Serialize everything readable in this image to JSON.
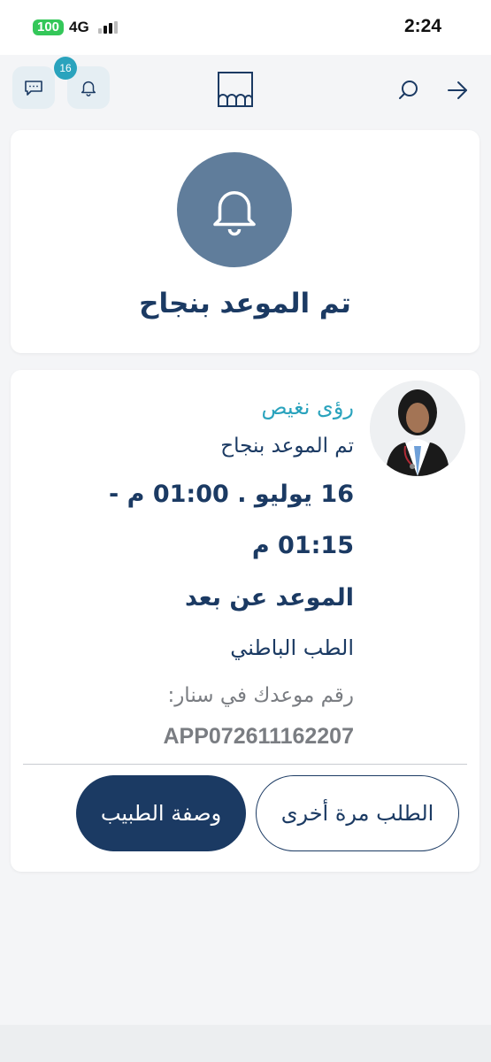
{
  "status_bar": {
    "battery": "100",
    "network": "4G",
    "time": "2:24"
  },
  "header": {
    "notification_count": "16",
    "icons": {
      "messages": "chat-icon",
      "notifications": "bell-icon",
      "logo": "app-logo",
      "search": "search-icon",
      "forward": "arrow-right-icon"
    }
  },
  "success": {
    "icon": "bell-icon",
    "title": "تم الموعد بنجاح"
  },
  "appointment": {
    "doctor_name": "رؤى نغيص",
    "status": "تم الموعد بنجاح",
    "date_line1": "16 يوليو . 01:00 م -",
    "date_line2": "01:15 م",
    "visit_type": "الموعد عن بعد",
    "specialty": "الطب الباطني",
    "ref_label": "رقم موعدك في سنار:",
    "ref_number": "APP072611162207"
  },
  "actions": {
    "prescription": "وصفة الطبيب",
    "reorder": "الطلب مرة أخرى"
  },
  "colors": {
    "primary": "#1b3a63",
    "accent": "#2aa3bd",
    "bell_circle": "#607d9b",
    "battery": "#34c759"
  }
}
